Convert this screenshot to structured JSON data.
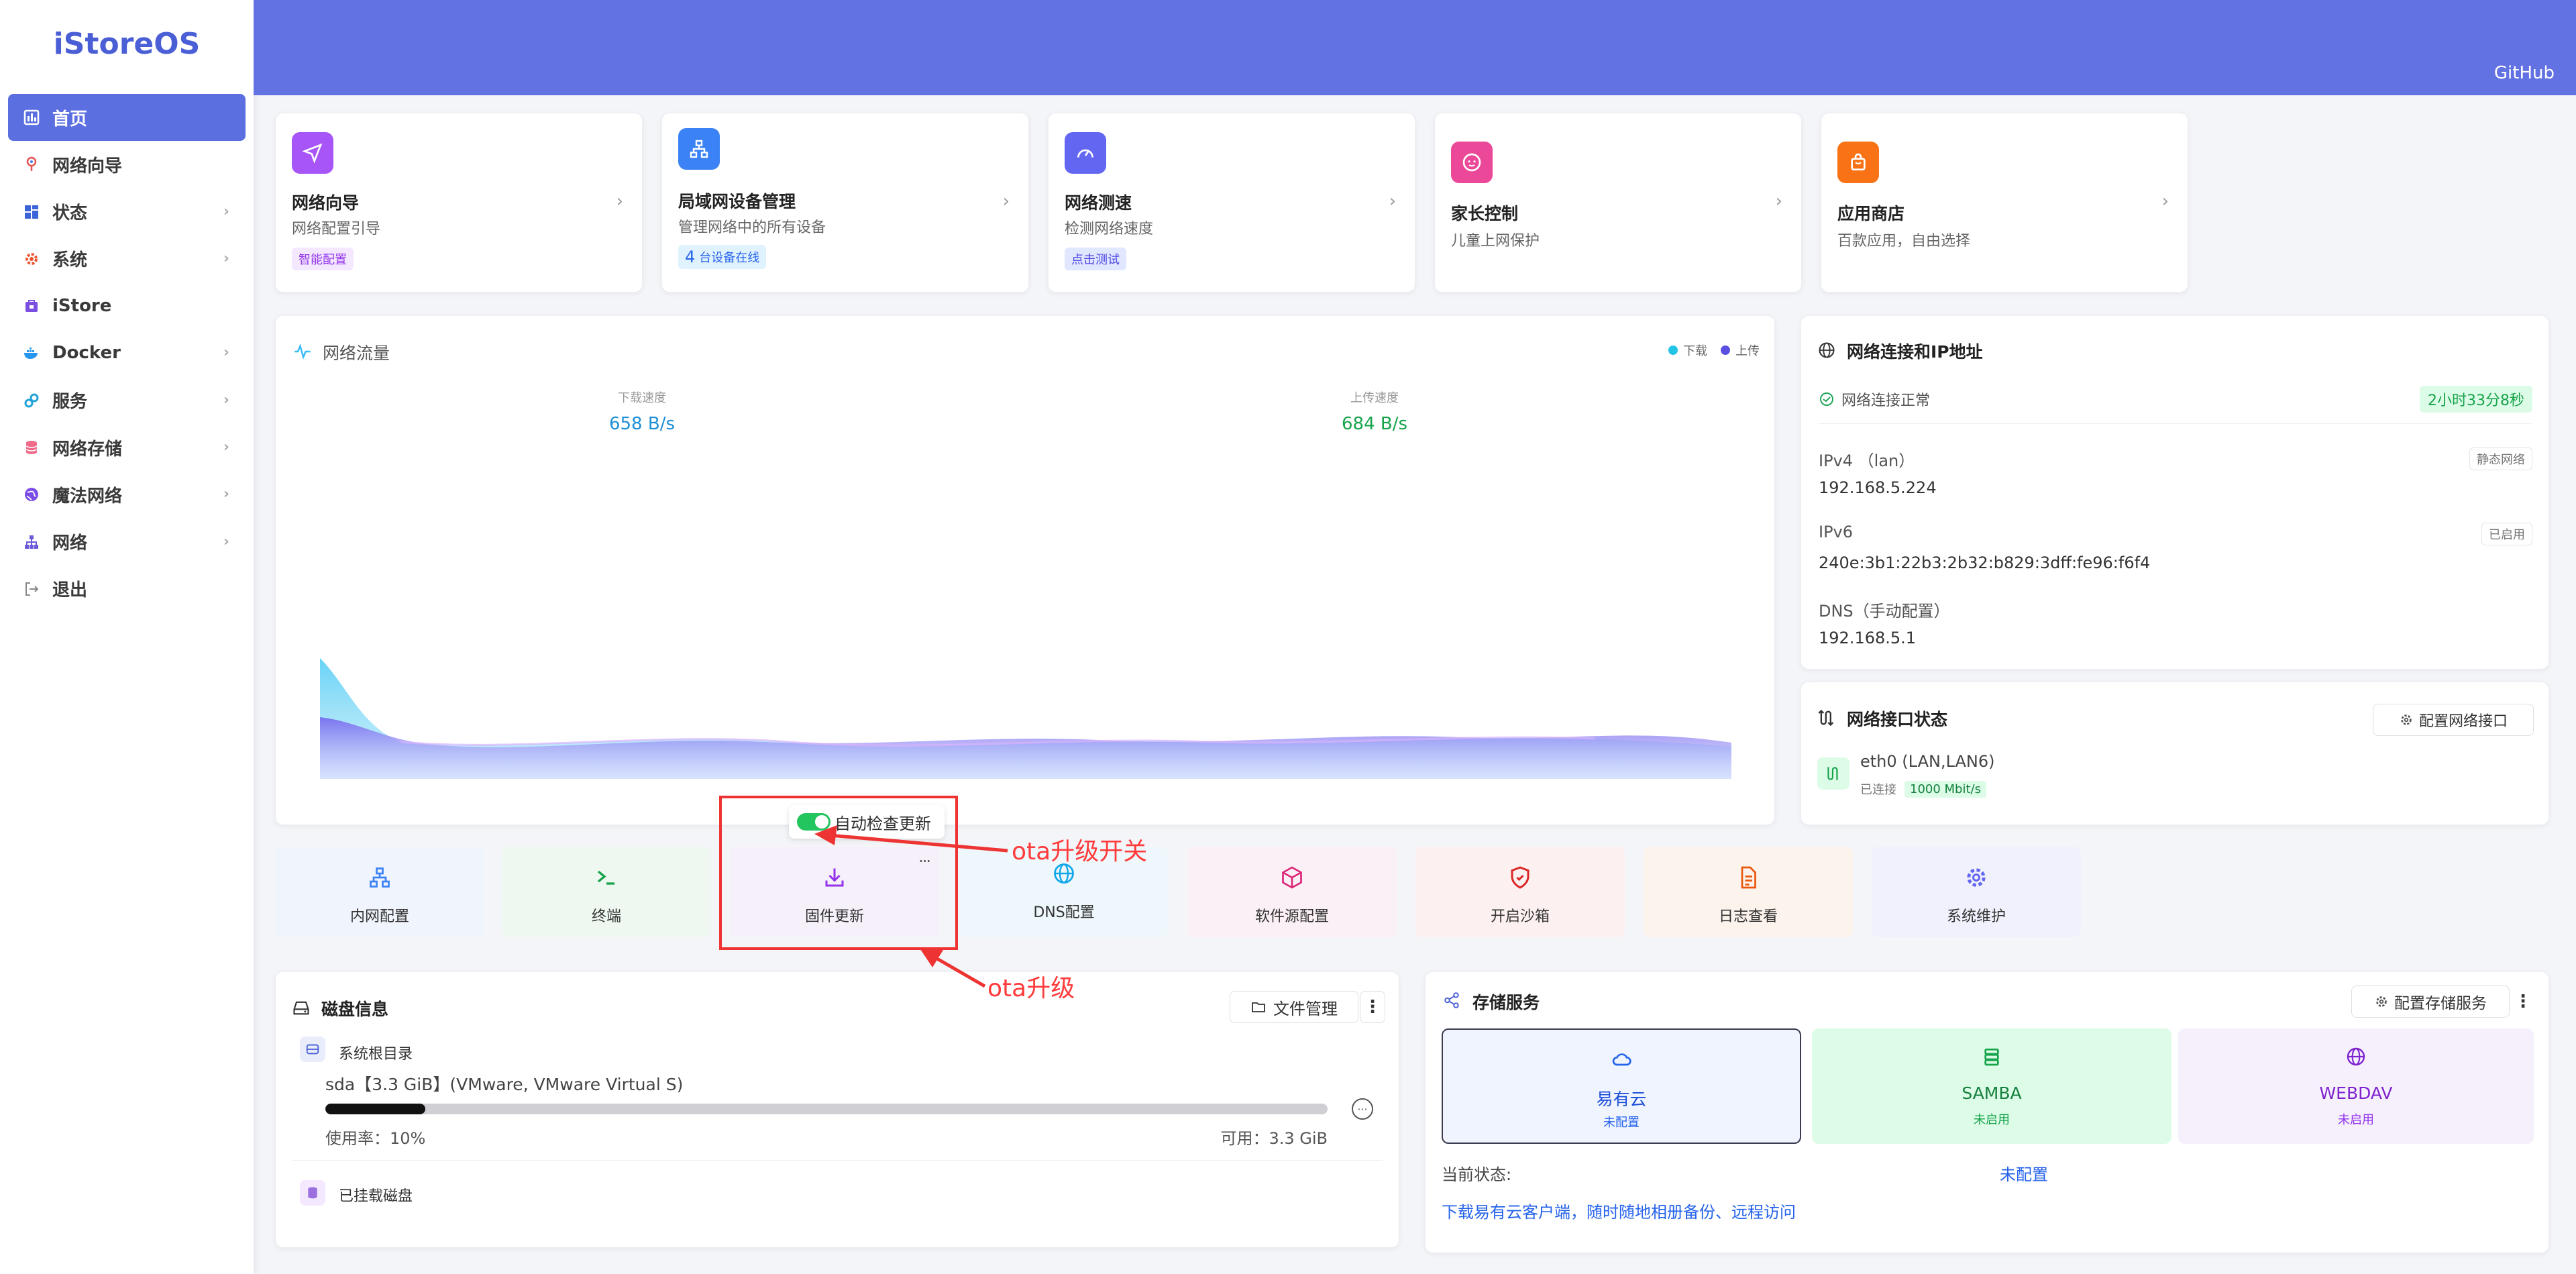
{
  "app": {
    "brand": "iStoreOS",
    "github": "GitHub"
  },
  "sidebar": {
    "items": [
      {
        "label": "首页",
        "icon": "dashboard-icon",
        "active": true
      },
      {
        "label": "网络向导",
        "icon": "wizard-icon"
      },
      {
        "label": "状态",
        "icon": "grid-icon"
      },
      {
        "label": "系统",
        "icon": "gear-icon"
      },
      {
        "label": "iStore",
        "icon": "store-icon"
      },
      {
        "label": "Docker",
        "icon": "docker-icon"
      },
      {
        "label": "服务",
        "icon": "link-icon"
      },
      {
        "label": "网络存储",
        "icon": "database-icon"
      },
      {
        "label": "魔法网络",
        "icon": "globe-icon"
      },
      {
        "label": "网络",
        "icon": "sitemap-icon"
      },
      {
        "label": "退出",
        "icon": "logout-icon"
      }
    ]
  },
  "quick_cards": [
    {
      "title": "网络向导",
      "subtitle": "网络配置引导",
      "tag": "智能配置"
    },
    {
      "title": "局域网设备管理",
      "subtitle": "管理网络中的所有设备",
      "count": "4",
      "tag": "台设备在线"
    },
    {
      "title": "网络测速",
      "subtitle": "检测网络速度",
      "tag": "点击测试"
    },
    {
      "title": "家长控制",
      "subtitle": "儿童上网保护"
    },
    {
      "title": "应用商店",
      "subtitle": "百款应用，自由选择"
    }
  ],
  "traffic": {
    "title": "网络流量",
    "legend_down": "下载",
    "legend_up": "上传",
    "down_label": "下载速度",
    "down_value": "658 B/s",
    "up_label": "上传速度",
    "up_value": "684 B/s"
  },
  "netinfo": {
    "title": "网络连接和IP地址",
    "status": "网络连接正常",
    "uptime": "2小时33分8秒",
    "ipv4_label": "IPv4 （lan）",
    "ipv4_value": "192.168.5.224",
    "ipv4_tag": "静态网络",
    "ipv6_label": "IPv6",
    "ipv6_value": "240e:3b1:22b3:2b32:b829:3dff:fe96:f6f4",
    "ipv6_tag": "已启用",
    "dns_label": "DNS（手动配置）",
    "dns_value": "192.168.5.1"
  },
  "iface": {
    "title": "网络接口状态",
    "config_button": "配置网络接口",
    "name": "eth0 (LAN,LAN6)",
    "state": "已连接",
    "speed": "1000 Mbit/s"
  },
  "ota": {
    "toggle_label": "自动检查更新",
    "toggle_on": true,
    "annotation_switch": "ota升级开关",
    "annotation_upgrade": "ota升级",
    "more": "···"
  },
  "shortcuts": [
    {
      "label": "内网配置",
      "icon": "network-icon",
      "color": "#3b82f6"
    },
    {
      "label": "终端",
      "icon": "terminal-icon",
      "color": "#16a34a"
    },
    {
      "label": "固件更新",
      "icon": "download-icon",
      "color": "#9333ea"
    },
    {
      "label": "DNS配置",
      "icon": "globe-icon",
      "color": "#0ea5e9"
    },
    {
      "label": "软件源配置",
      "icon": "box-icon",
      "color": "#db2777"
    },
    {
      "label": "开启沙箱",
      "icon": "shield-icon",
      "color": "#dc2626"
    },
    {
      "label": "日志查看",
      "icon": "file-icon",
      "color": "#ea580c"
    },
    {
      "label": "系统维护",
      "icon": "gear-icon",
      "color": "#6366f1"
    }
  ],
  "disk": {
    "title": "磁盘信息",
    "file_manager": "文件管理",
    "root_label": "系统根目录",
    "device": "sda【3.3 GiB】(VMware, VMware Virtual S)",
    "usage": "使用率：10%",
    "usage_fraction": 0.1,
    "available": "可用：3.3 GiB",
    "mounted": "已挂载磁盘"
  },
  "storage": {
    "title": "存储服务",
    "config_button": "配置存储服务",
    "services": [
      {
        "name": "易有云",
        "state": "未配置",
        "color": "#2563eb"
      },
      {
        "name": "SAMBA",
        "state": "未启用",
        "color": "#15803d"
      },
      {
        "name": "WEBDAV",
        "state": "未启用",
        "color": "#7e22ce"
      }
    ],
    "status_label": "当前状态:",
    "status_value": "未配置",
    "download_link": "下载易有云客户端，随时随地相册备份、远程访问"
  }
}
